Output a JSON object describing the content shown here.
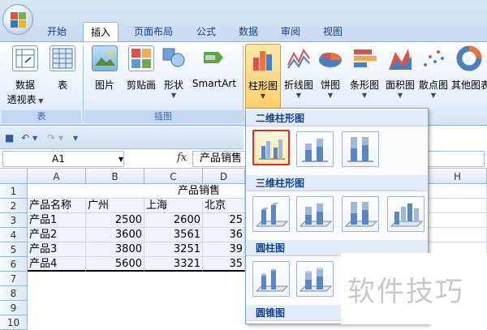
{
  "tabs": [
    {
      "label": "开始",
      "active": false
    },
    {
      "label": "插入",
      "active": true
    },
    {
      "label": "页面布局",
      "active": false
    },
    {
      "label": "公式",
      "active": false
    },
    {
      "label": "数据",
      "active": false
    },
    {
      "label": "审阅",
      "active": false
    },
    {
      "label": "视图",
      "active": false
    }
  ],
  "ribbon": {
    "tables_group": {
      "label": "表",
      "pivot_label": "数据",
      "pivot_label2": "透视表",
      "table_label": "表"
    },
    "illustrations_group": {
      "label": "插图",
      "picture": "图片",
      "clipart": "剪贴画",
      "shapes": "形状",
      "smartart": "SmartArt"
    },
    "charts": {
      "column": "柱形图",
      "line": "折线图",
      "pie": "饼图",
      "bar": "条形图",
      "area": "面积图",
      "scatter": "散点图",
      "other": "其他图表"
    }
  },
  "formula_bar": {
    "name_box": "A1",
    "fx": "fx",
    "content": "产品销售"
  },
  "columns": [
    "A",
    "B",
    "C",
    "D",
    "H"
  ],
  "rows": [
    "1",
    "2",
    "3",
    "4",
    "5",
    "6",
    "7",
    "8",
    "9",
    "10"
  ],
  "sheet": {
    "title": "产品销售",
    "headers": [
      "产品名称",
      "广州",
      "上海",
      "北京"
    ],
    "data": [
      [
        "产品1",
        "2500",
        "2600",
        "25"
      ],
      [
        "产品2",
        "3600",
        "3561",
        "36"
      ],
      [
        "产品3",
        "3800",
        "3251",
        "39"
      ],
      [
        "产品4",
        "5600",
        "3321",
        "35"
      ]
    ]
  },
  "gallery": {
    "sections": [
      "二维柱形图",
      "三维柱形图",
      "圆柱图",
      "圆锥图"
    ]
  },
  "watermark": "软件技巧",
  "colors": {
    "accent": "#15428b",
    "highlight": "#d9302a",
    "ribbon": "#dfe9f5"
  }
}
